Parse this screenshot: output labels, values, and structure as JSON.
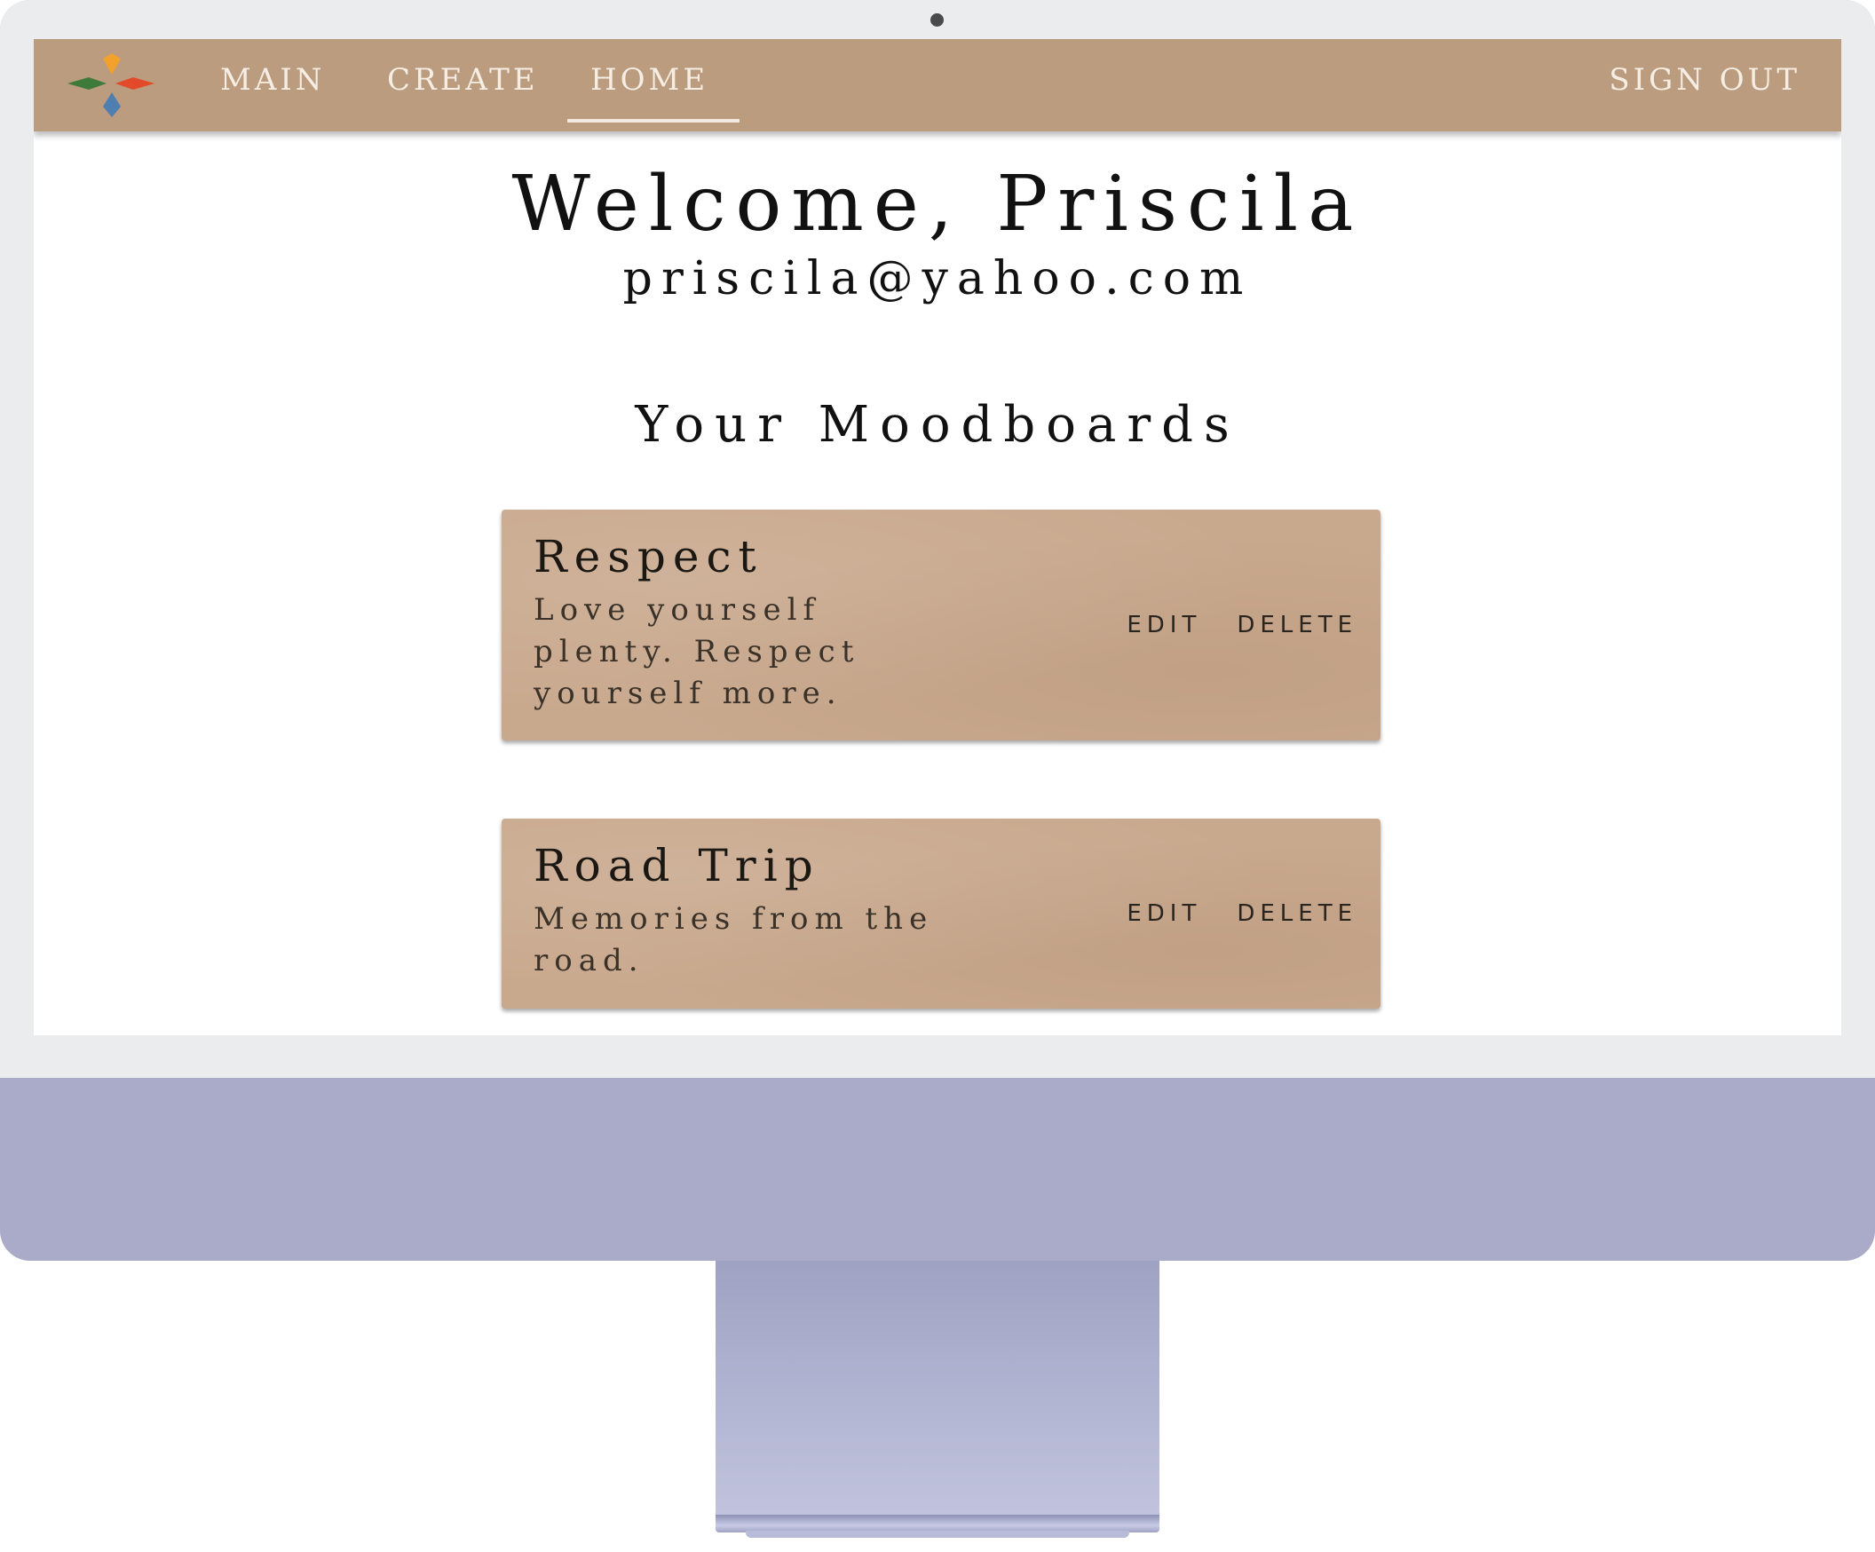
{
  "nav": {
    "items": [
      {
        "label": "MAIN"
      },
      {
        "label": "CREATE"
      },
      {
        "label": "HOME"
      }
    ],
    "active": "HOME",
    "signout_label": "SIGN OUT"
  },
  "welcome": {
    "title": "Welcome, Priscila",
    "email": "priscila@yahoo.com"
  },
  "moodboards": {
    "heading": "Your Moodboards",
    "cards": [
      {
        "title": "Respect",
        "description": "Love yourself plenty. Respect yourself more.",
        "edit_label": "EDIT",
        "delete_label": "DELETE"
      },
      {
        "title": "Road Trip",
        "description": "Memories from the road.",
        "edit_label": "EDIT",
        "delete_label": "DELETE"
      }
    ]
  },
  "colors": {
    "navbar": "#bb9c7e",
    "card": "#c9a98e",
    "monitor_body": "#a9abc8",
    "bezel": "#ebecee",
    "logo_orange": "#f2a12c",
    "logo_red": "#e24a2a",
    "logo_green": "#3e7a3a",
    "logo_blue": "#4f7fb0"
  }
}
